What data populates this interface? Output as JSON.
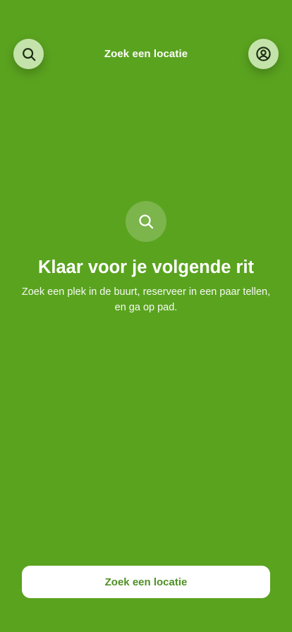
{
  "header": {
    "title": "Zoek een locatie",
    "left_icon": "search-icon",
    "right_icon": "user-circle-icon"
  },
  "hero": {
    "icon": "search-icon",
    "title": "Klaar voor je volgende rit",
    "text": "Zoek een plek in de buurt, reserveer in een paar tellen, en ga op pad."
  },
  "cta": {
    "label": "Zoek een locatie"
  },
  "colors": {
    "background": "#5aa31f",
    "button_circle": "#c4e3aa",
    "cta_text": "#4f8f24",
    "white": "#ffffff"
  }
}
